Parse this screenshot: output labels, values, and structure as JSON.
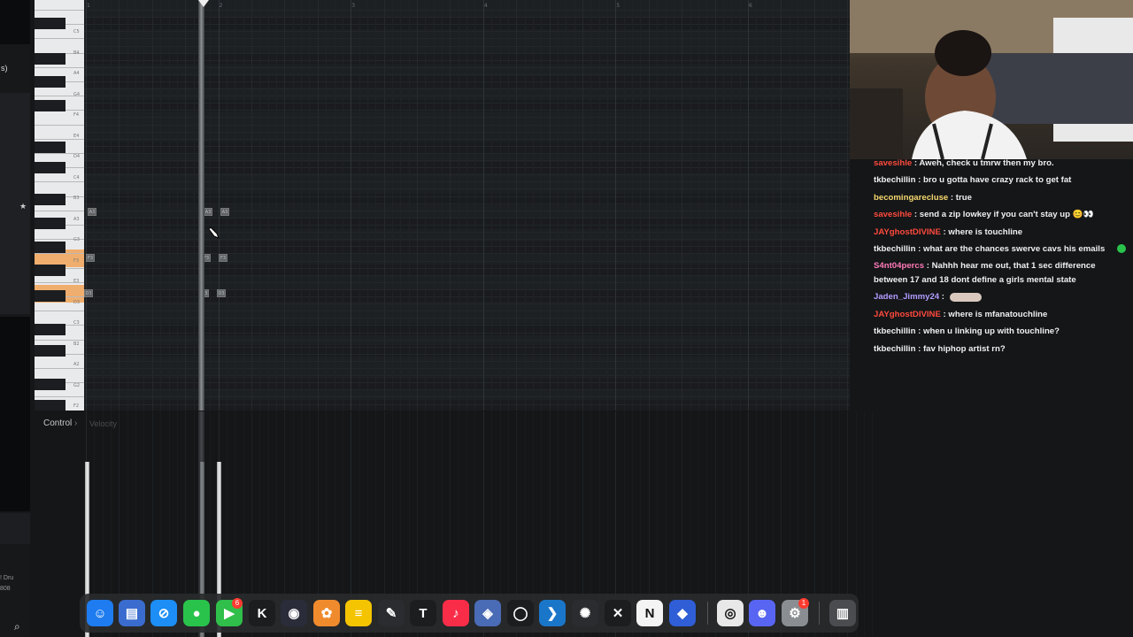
{
  "piano_roll": {
    "bar_numbers": [
      "1",
      "2",
      "3",
      "4",
      "5",
      "6"
    ],
    "key_labels": [
      "C5",
      "B4",
      "A4",
      "G4",
      "F4",
      "E4",
      "D4",
      "C4",
      "B3",
      "A3",
      "G3",
      "F3",
      "E3",
      "D3",
      "C3",
      "B2",
      "A2",
      "G2",
      "F2"
    ],
    "notes": [
      {
        "label": "A3"
      },
      {
        "label": "A3"
      },
      {
        "label": "A3"
      },
      {
        "label": "F3"
      },
      {
        "label": "F3"
      },
      {
        "label": "F3"
      },
      {
        "label": "D3"
      },
      {
        "label": "D3"
      },
      {
        "label": "D3"
      }
    ]
  },
  "control": {
    "label": "Control",
    "arrow": "›",
    "sub": "Velocity"
  },
  "left_panel": {
    "fragment_top": "s)",
    "fragment_bottom_1": "! Dru",
    "fragment_bottom_2": "808"
  },
  "chat": {
    "messages": [
      {
        "user": "savesihle",
        "color": "#ff4a3d",
        "text": ": Aweh, check u tmrw then my bro."
      },
      {
        "user": "tkbechillin",
        "color": "#f0f0f0",
        "text": ": bro u gotta have crazy rack to get fat"
      },
      {
        "user": "becomingarecluse",
        "color": "#f5d76e",
        "text": ": true"
      },
      {
        "user": "savesihle",
        "color": "#ff4a3d",
        "text": ": send a zip lowkey if you can't stay up 😊👀"
      },
      {
        "user": "JAYghostDIVINE",
        "color": "#ff4a3d",
        "text": ": where is touchline"
      },
      {
        "user": "tkbechillin",
        "color": "#f0f0f0",
        "text": ": what are the chances swerve cavs his emails"
      },
      {
        "user": "S4nt04percs",
        "color": "#ff7ab8",
        "text": ": Nahhh hear me out, that 1 sec difference between 17 and 18 dont define a girls mental state"
      },
      {
        "user": "Jaden_Jimmy24",
        "color": "#b39cff",
        "text": ":"
      },
      {
        "user": "JAYghostDIVINE",
        "color": "#ff4a3d",
        "text": ": where is mfanatouchline"
      },
      {
        "user": "tkbechillin",
        "color": "#f0f0f0",
        "text": ": when u linking up with touchline?"
      },
      {
        "user": "tkbechillin",
        "color": "#f0f0f0",
        "text": ": fav hiphop artist rn?"
      }
    ]
  },
  "dock": {
    "apps": [
      {
        "name": "finder-icon",
        "glyph": "☺",
        "color": "#1e7cf0"
      },
      {
        "name": "files-icon",
        "glyph": "▤",
        "color": "#3a6ccf"
      },
      {
        "name": "safari-icon",
        "glyph": "⊘",
        "color": "#1c8ef5"
      },
      {
        "name": "messages-icon",
        "glyph": "●",
        "color": "#29c34c"
      },
      {
        "name": "facetime-icon",
        "glyph": "▶",
        "color": "#2fbf4a"
      },
      {
        "name": "kick-icon",
        "glyph": "K",
        "color": "#1b1d1f"
      },
      {
        "name": "obs-icon",
        "glyph": "◉",
        "color": "#2a2c3a"
      },
      {
        "name": "fl-studio-icon",
        "glyph": "✿",
        "color": "#f08b2d"
      },
      {
        "name": "notes-icon",
        "glyph": "≡",
        "color": "#f5c400"
      },
      {
        "name": "pen-icon",
        "glyph": "✎",
        "color": "#2a2c2f"
      },
      {
        "name": "tradingview-icon",
        "glyph": "T",
        "color": "#1b1d1f"
      },
      {
        "name": "music-icon",
        "glyph": "♪",
        "color": "#fa2d48"
      },
      {
        "name": "davinci-icon",
        "glyph": "◈",
        "color": "#4a6bb5"
      },
      {
        "name": "github-icon",
        "glyph": "◯",
        "color": "#1b1d1f"
      },
      {
        "name": "vscode-icon",
        "glyph": "❯",
        "color": "#1a76c9"
      },
      {
        "name": "chatgpt-icon",
        "glyph": "✺",
        "color": "#2a2c2f"
      },
      {
        "name": "capcut-icon",
        "glyph": "✕",
        "color": "#1b1d1f"
      },
      {
        "name": "notion-icon",
        "glyph": "N",
        "color": "#f4f4f4"
      },
      {
        "name": "app-blue-icon",
        "glyph": "◆",
        "color": "#2f5ed6"
      },
      {
        "name": "chrome-icon",
        "glyph": "◎",
        "color": "#e8e8e8"
      },
      {
        "name": "discord-icon",
        "glyph": "☻",
        "color": "#5865f2"
      },
      {
        "name": "system-settings-icon",
        "glyph": "⚙",
        "color": "#8a8d91"
      },
      {
        "name": "trash-icon",
        "glyph": "▥",
        "color": "#4a4c4f"
      }
    ],
    "badges": {
      "facetime": "6",
      "settings": "1"
    }
  }
}
